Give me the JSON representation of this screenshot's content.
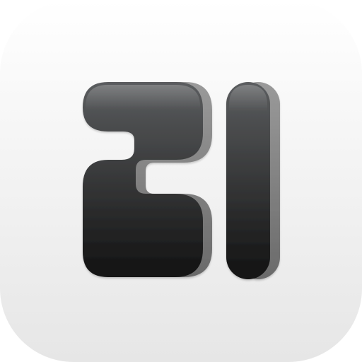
{
  "icon": {
    "semantic": "app-icon-21",
    "glyph": "21",
    "colors": {
      "tile_top": "#ffffff",
      "tile_bottom": "#e6e6e6",
      "glyph_top": "#5b5d5f",
      "glyph_bottom": "#121212",
      "glyph_side": "#787878",
      "glyph_highlight": "#8a8c8e"
    }
  }
}
